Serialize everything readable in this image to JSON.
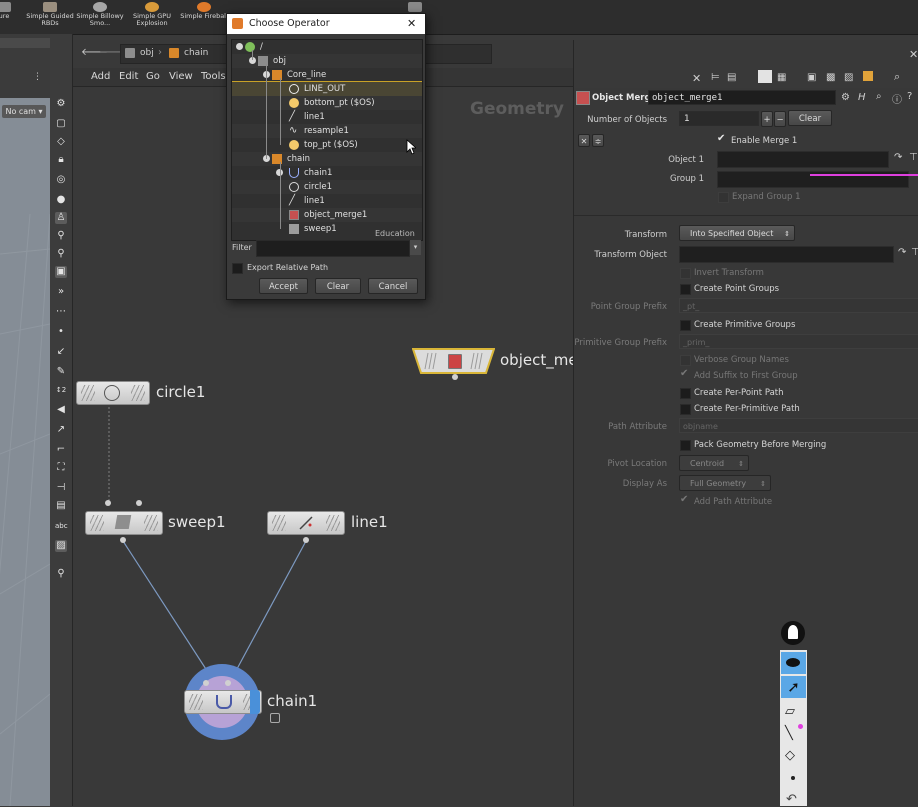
{
  "shelf": {
    "tools": [
      {
        "label": "ure",
        "icon": "shelf-tool-icon"
      },
      {
        "label": "Simple Guided RBDs",
        "icon": "rbd-icon"
      },
      {
        "label": "Simple Billowy Smo...",
        "icon": "smoke-icon"
      },
      {
        "label": "Simple GPU Explosion",
        "icon": "explosion-icon"
      },
      {
        "label": "Simple Fireball",
        "icon": "fireball-icon"
      },
      {
        "label": "re",
        "icon": "shelf-tool-icon"
      }
    ]
  },
  "viewport": {
    "camera": "No cam ▾",
    "help": "?"
  },
  "network": {
    "path": [
      "obj",
      "chain"
    ],
    "menu": [
      "Add",
      "Edit",
      "Go",
      "View",
      "Tools"
    ],
    "context_label": "Geometry",
    "nodes": {
      "object_merge": "object_me",
      "circle": "circle1",
      "sweep": "sweep1",
      "line": "line1",
      "chain": "chain1"
    }
  },
  "dialog": {
    "title": "Choose Operator",
    "close": "✕",
    "tree": [
      {
        "label": "/",
        "depth": 0
      },
      {
        "label": "obj",
        "depth": 1
      },
      {
        "label": "Core_line",
        "depth": 2
      },
      {
        "label": "LINE_OUT",
        "depth": 3,
        "selected": true
      },
      {
        "label": "bottom_pt ($OS)",
        "depth": 3
      },
      {
        "label": "line1",
        "depth": 3
      },
      {
        "label": "resample1",
        "depth": 3
      },
      {
        "label": "top_pt ($OS)",
        "depth": 3
      },
      {
        "label": "chain",
        "depth": 2
      },
      {
        "label": "chain1",
        "depth": 3
      },
      {
        "label": "circle1",
        "depth": 3
      },
      {
        "label": "line1",
        "depth": 3
      },
      {
        "label": "object_merge1",
        "depth": 3
      },
      {
        "label": "sweep1",
        "depth": 3
      },
      {
        "label": "Education",
        "depth": 4
      }
    ],
    "filter_label": "Filter",
    "export_relative": "Export Relative Path",
    "buttons": {
      "accept": "Accept",
      "clear": "Clear",
      "cancel": "Cancel"
    }
  },
  "parm": {
    "node_type": "Object Merge",
    "node_name": "object_merge1",
    "number_of_objects_label": "Number of Objects",
    "number_of_objects": "1",
    "plus": "+",
    "minus": "−",
    "clear": "Clear",
    "enable_merge": "Enable Merge 1",
    "object1_label": "Object 1",
    "group1_label": "Group 1",
    "expand_group": "Expand Group 1",
    "transform_label": "Transform",
    "transform_value": "Into Specified Object",
    "transform_object_label": "Transform Object",
    "invert_transform": "Invert Transform",
    "create_point_groups": "Create Point Groups",
    "point_group_prefix_label": "Point Group Prefix",
    "point_group_prefix": "_pt_",
    "create_primitive_groups": "Create Primitive Groups",
    "primitive_group_prefix_label": "Primitive Group Prefix",
    "primitive_group_prefix": "_prim_",
    "verbose_group_names": "Verbose Group Names",
    "add_suffix": "Add Suffix to First Group",
    "create_per_point_path": "Create Per-Point Path",
    "create_per_primitive_path": "Create Per-Primitive Path",
    "path_attribute_label": "Path Attribute",
    "path_attribute": "objname",
    "pack_geometry": "Pack Geometry Before Merging",
    "pivot_location_label": "Pivot Location",
    "pivot_location": "Centroid",
    "display_as_label": "Display As",
    "display_as": "Full Geometry",
    "add_path_attribute": "Add Path Attribute",
    "accent_color": "#e040e0"
  },
  "floatbar": {
    "tools": [
      "eye-icon",
      "select-arrow-icon",
      "brush-icon",
      "pen-icon",
      "eraser-icon",
      "dot-icon",
      "undo-icon"
    ]
  }
}
